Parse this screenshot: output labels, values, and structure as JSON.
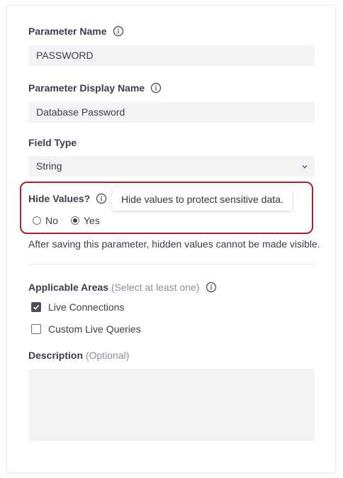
{
  "parameter_name": {
    "label": "Parameter Name",
    "value": "PASSWORD",
    "info_icon": "info-icon"
  },
  "display_name": {
    "label": "Parameter Display Name",
    "value": "Database Password",
    "info_icon": "info-icon"
  },
  "field_type": {
    "label": "Field Type",
    "selected": "String",
    "chevron_icon": "chevron-down-icon"
  },
  "hide_values": {
    "label": "Hide Values?",
    "info_icon": "info-icon",
    "tooltip": "Hide values to protect sensitive data.",
    "options": [
      {
        "label": "No",
        "checked": false
      },
      {
        "label": "Yes",
        "checked": true
      }
    ],
    "note": "After saving this parameter, hidden values cannot be made visible.",
    "highlight_color": "#b0202b"
  },
  "applicable_areas": {
    "label": "Applicable Areas",
    "hint": "(Select at least one)",
    "info_icon": "info-icon",
    "options": [
      {
        "label": "Live Connections",
        "checked": true
      },
      {
        "label": "Custom Live Queries",
        "checked": false
      }
    ]
  },
  "description": {
    "label": "Description",
    "hint": "(Optional)",
    "value": ""
  }
}
